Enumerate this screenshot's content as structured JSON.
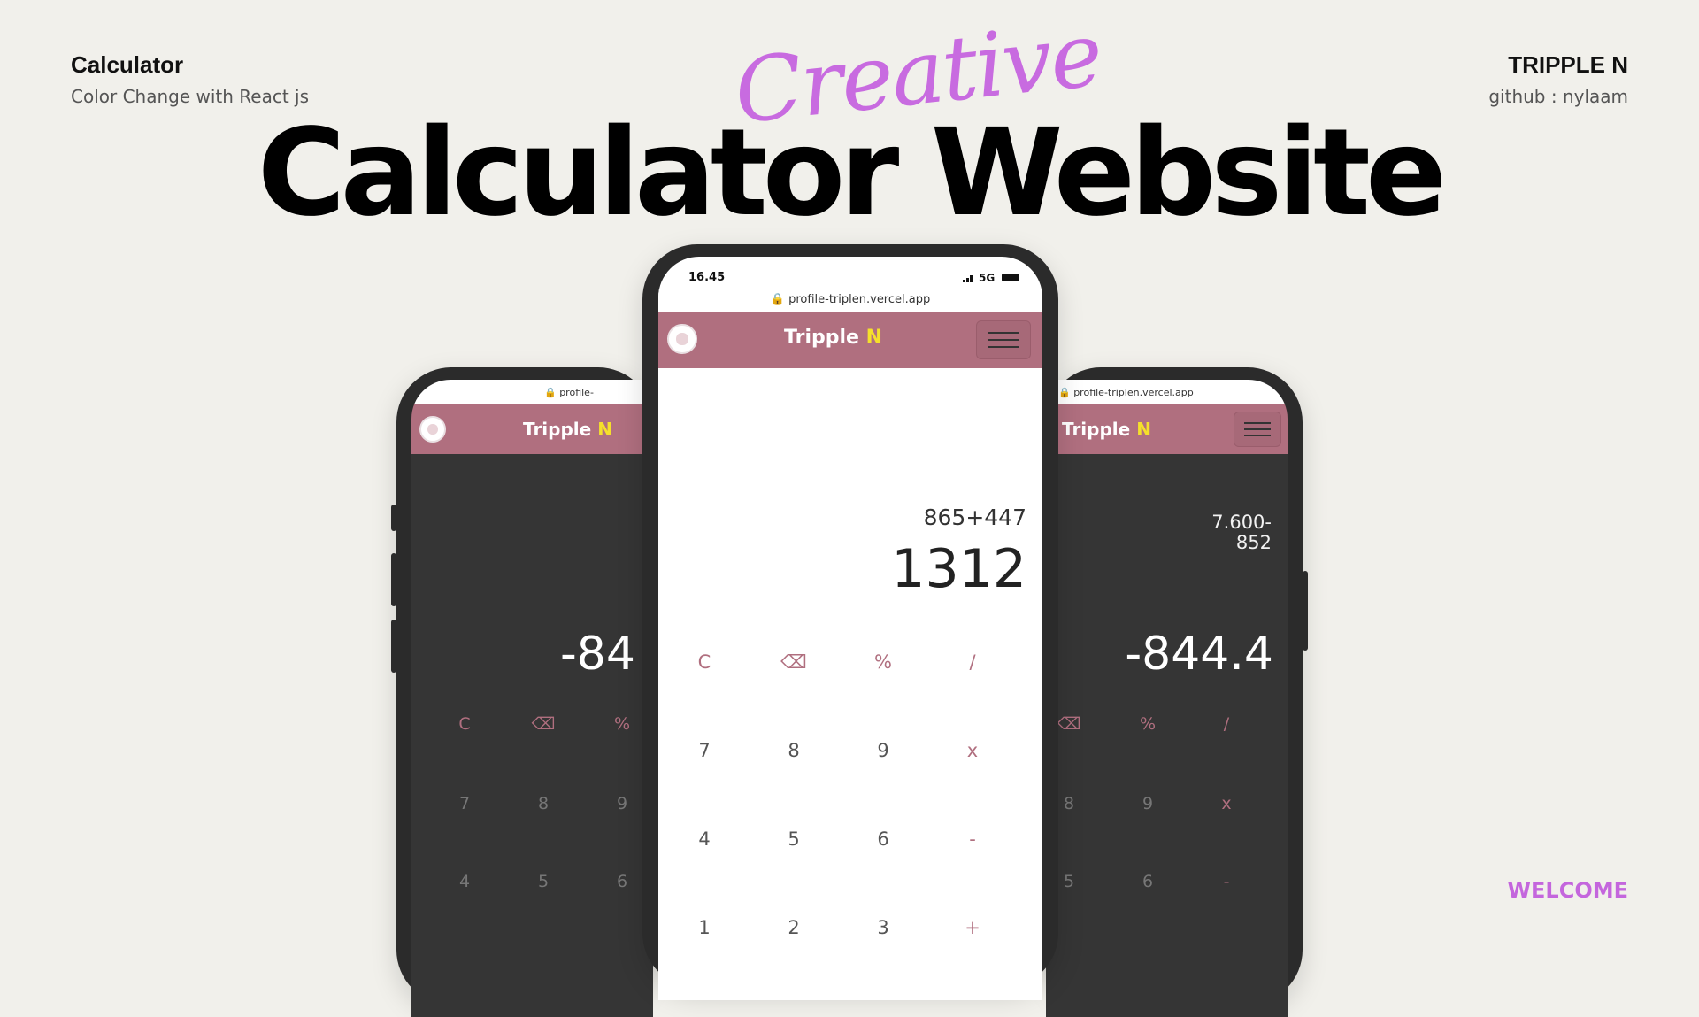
{
  "header": {
    "left_title": "Calculator",
    "left_subtitle": "Color Change with React js",
    "right_title": "TRIPPLE N",
    "right_subtitle": "github : nylaam",
    "script_word": "Creative",
    "main_title": "Calculator Website",
    "footer_label": "WELCOME"
  },
  "colors": {
    "accent": "#c86be0",
    "navbar": "#b06f7f",
    "brand_highlight": "#f5e02b",
    "dark_bg": "#353535",
    "background": "#f1f0eb"
  },
  "app": {
    "url": "profile-triplen.vercel.app",
    "brand": "Tripple",
    "brand_highlight": "N",
    "status_time": "16.45",
    "status_network": "5G"
  },
  "phones": {
    "center": {
      "expression": "865+447",
      "result": "1312",
      "keys": [
        [
          "C",
          "⌫",
          "%",
          "/"
        ],
        [
          "7",
          "8",
          "9",
          "x"
        ],
        [
          "4",
          "5",
          "6",
          "-"
        ],
        [
          "1",
          "2",
          "3",
          "+"
        ]
      ]
    },
    "left": {
      "result": "-84",
      "keys": [
        [
          "C",
          "⌫",
          "%"
        ],
        [
          "7",
          "8",
          "9"
        ],
        [
          "4",
          "5",
          "6"
        ]
      ]
    },
    "right": {
      "expression_line1": "7.600-",
      "expression_line2": "852",
      "result": "-844.4",
      "keys": [
        [
          "⌫",
          "%",
          "/"
        ],
        [
          "8",
          "9",
          "x"
        ],
        [
          "5",
          "6",
          "-"
        ]
      ]
    }
  }
}
